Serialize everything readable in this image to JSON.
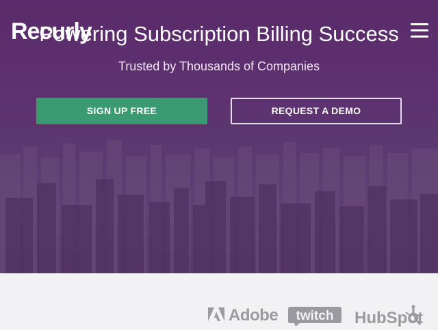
{
  "brand": {
    "logo_text": "Recurly"
  },
  "hero": {
    "headline": "Powering Subscription Billing Success",
    "subheadline": "Trusted by Thousands of Companies",
    "primary_button": "SIGN UP FREE",
    "secondary_button": "REQUEST A DEMO"
  },
  "customers": {
    "logos": [
      {
        "name": "Adobe",
        "icon": "adobe-logo-icon"
      },
      {
        "name": "twitch",
        "icon": "twitch-logo-icon"
      },
      {
        "name": "HubSpot",
        "icon": "hubspot-logo-icon"
      }
    ]
  },
  "colors": {
    "hero_overlay": "#5a2b6a",
    "primary_button": "#3a9a72",
    "logo_gray": "#9a9aa0",
    "strip_background": "#f2f2f4"
  }
}
